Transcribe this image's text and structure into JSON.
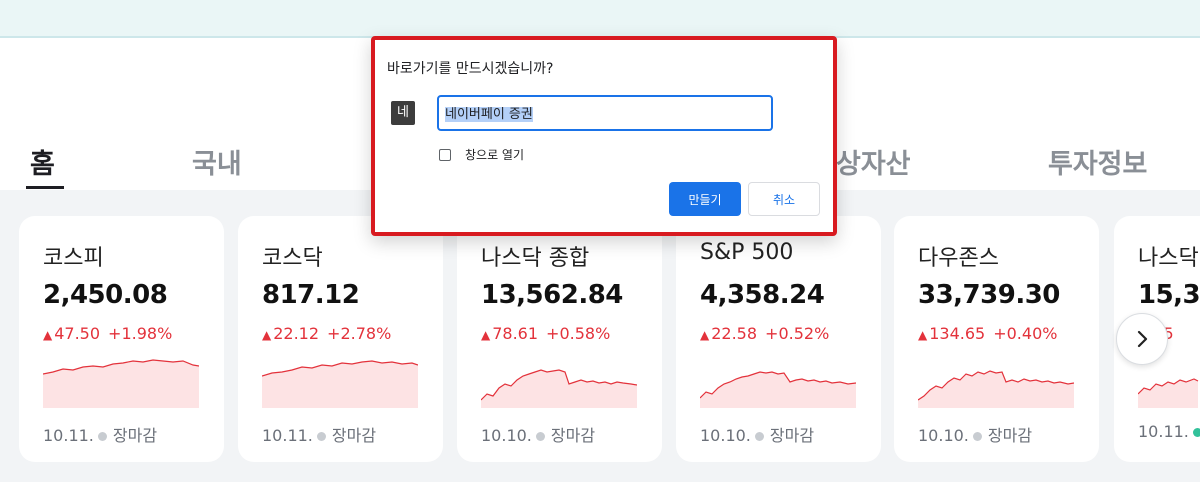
{
  "tabs": [
    {
      "label": "홈",
      "active": true
    },
    {
      "label": "국내",
      "active": false
    },
    {
      "label": "상자산",
      "active": false
    },
    {
      "label": "투자정보",
      "active": false
    }
  ],
  "cards": [
    {
      "name": "코스피",
      "price": "2,450.08",
      "change": "47.50",
      "pct": "+1.98%",
      "date": "10.11.",
      "status": "장마감"
    },
    {
      "name": "코스닥",
      "price": "817.12",
      "change": "22.12",
      "pct": "+2.78%",
      "date": "10.11.",
      "status": "장마감"
    },
    {
      "name": "나스닥 종합",
      "price": "13,562.84",
      "change": "78.61",
      "pct": "+0.58%",
      "date": "10.10.",
      "status": "장마감"
    },
    {
      "name": "S&P 500",
      "price": "4,358.24",
      "change": "22.58",
      "pct": "+0.52%",
      "date": "10.10.",
      "status": "장마감"
    },
    {
      "name": "다우존스",
      "price": "33,739.30",
      "change": "134.65",
      "pct": "+0.40%",
      "date": "10.10.",
      "status": "장마감"
    },
    {
      "name": "나스닥",
      "price": "15,3",
      "change": "",
      "pct": "6.75",
      "date": "10.11.",
      "status": ""
    }
  ],
  "dialog": {
    "title": "바로가기를 만드시겠습니까?",
    "favicon_text": "네",
    "name_value": "네이버페이 증권",
    "checkbox_label": "창으로 열기",
    "create_label": "만들기",
    "cancel_label": "취소"
  },
  "colors": {
    "up": "#e3323b",
    "accent": "#1a73e8",
    "highlight": "#d81a20"
  },
  "icons": {
    "next": "chevron-right-icon",
    "change_up": "triangle-up-icon"
  }
}
